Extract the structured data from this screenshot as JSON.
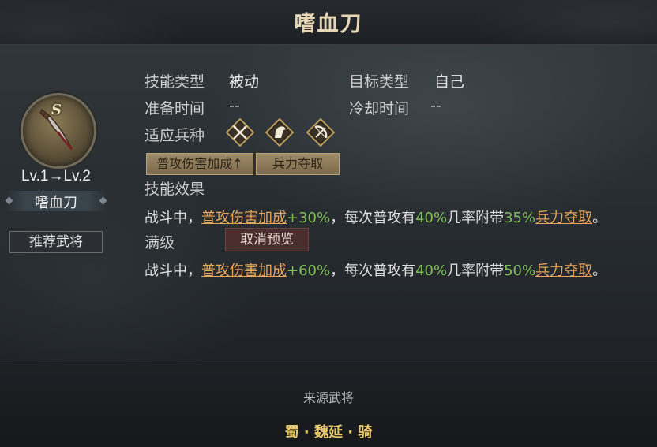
{
  "title": "嗜血刀",
  "left": {
    "grade": "S",
    "level": "Lv.1→Lv.2",
    "skill_name": "嗜血刀",
    "recommend_button": "推荐武将"
  },
  "info": {
    "skill_type_label": "技能类型",
    "skill_type_value": "被动",
    "target_type_label": "目标类型",
    "target_type_value": "自己",
    "prep_time_label": "准备时间",
    "prep_time_value": "--",
    "cooldown_label": "冷却时间",
    "cooldown_value": "--",
    "troop_label": "适应兵种",
    "troop_icons": [
      "crossed-spears-icon",
      "horse-icon",
      "bow-icon"
    ],
    "tags": [
      "普攻伤害加成↑",
      "兵力夺取"
    ],
    "effect_label": "技能效果"
  },
  "effect": {
    "line1": {
      "prefix": "战斗中，",
      "link1": "普攻伤害加成",
      "bonus": "+30%",
      "mid1": "，每次普攻有",
      "chance": "40%",
      "mid2": "几率附带",
      "steal": "35%",
      "link2": "兵力夺取",
      "end": "。"
    },
    "max_label": "满级",
    "cancel_preview_button": "取消预览",
    "line2": {
      "prefix": "战斗中，",
      "link1": "普攻伤害加成",
      "bonus": "+60%",
      "mid1": "，每次普攻有",
      "chance": "40%",
      "mid2": "几率附带",
      "steal": "50%",
      "link2": "兵力夺取",
      "end": "。"
    }
  },
  "source": {
    "label": "来源武将",
    "general": "蜀 · 魏延 · 骑"
  },
  "colors": {
    "title_gold": "#e6d7b5",
    "link_orange": "#e8a55c",
    "value_green": "#7fbf5a",
    "source_gold": "#e8c86a"
  }
}
